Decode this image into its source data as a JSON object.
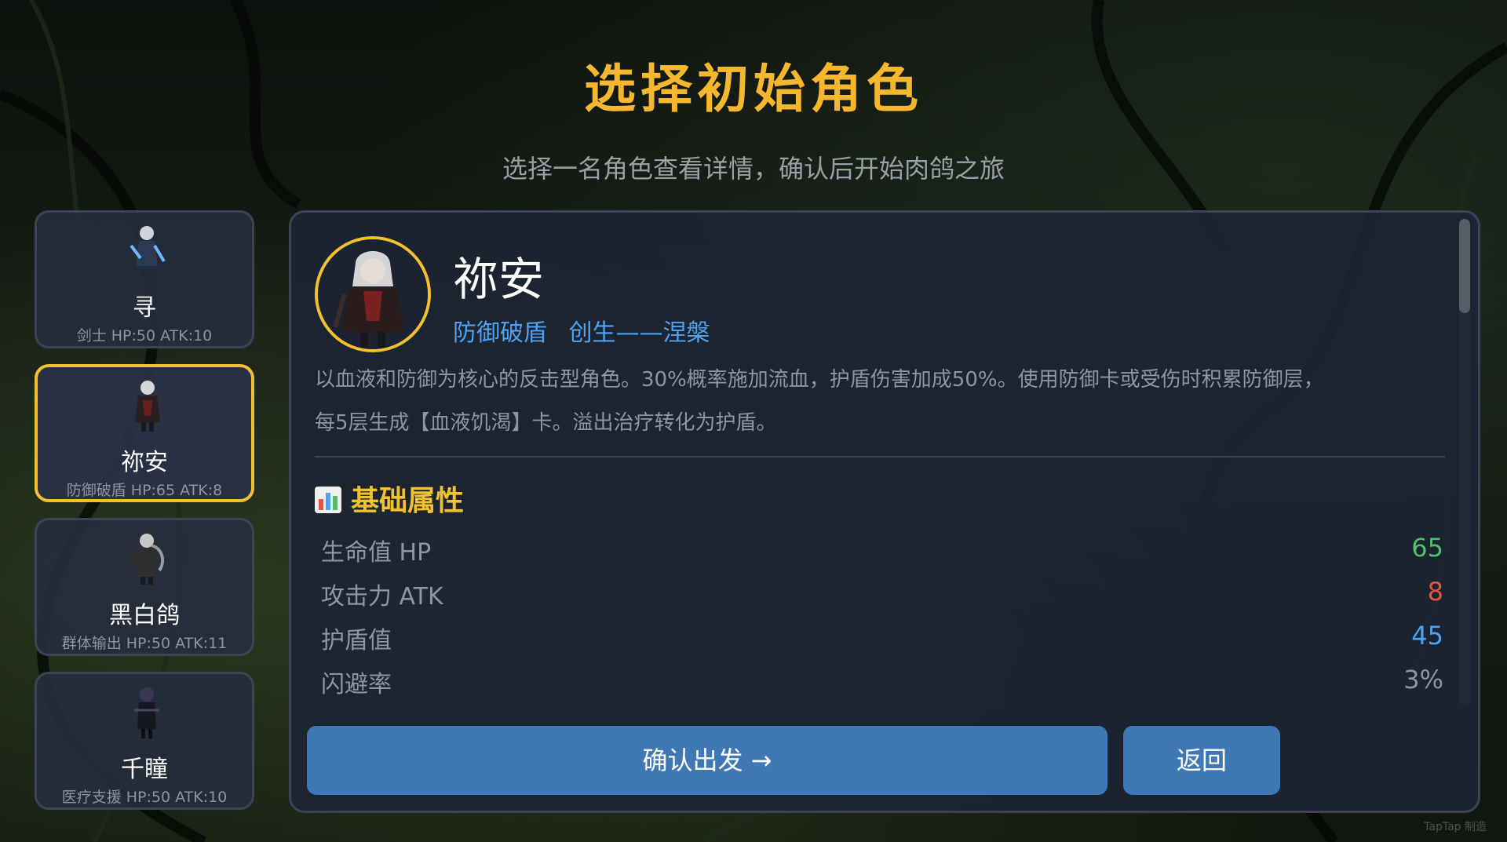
{
  "header": {
    "title": "选择初始角色",
    "subtitle": "选择一名角色查看详情，确认后开始肉鸽之旅"
  },
  "characters": [
    {
      "name": "寻",
      "meta": "剑士  HP:50 ATK:10",
      "selected": false
    },
    {
      "name": "祢安",
      "meta": "防御破盾  HP:65 ATK:8",
      "selected": true
    },
    {
      "name": "黑白鸽",
      "meta": "群体输出  HP:50 ATK:11",
      "selected": false
    },
    {
      "name": "千瞳",
      "meta": "医疗支援  HP:50 ATK:10",
      "selected": false
    }
  ],
  "detail": {
    "name": "祢安",
    "tags": [
      "防御破盾",
      "创生——涅槃"
    ],
    "description_line1": "以血液和防御为核心的反击型角色。30%概率施加流血，护盾伤害加成50%。使用防御卡或受伤时积累防御层，",
    "description_line2": "每5层生成【血液饥渴】卡。溢出治疗转化为护盾。",
    "section_title": "基础属性",
    "section_icon": "bar-chart-icon",
    "attributes": [
      {
        "label": "生命值 HP",
        "value": "65",
        "color": "#4cc26a"
      },
      {
        "label": "攻击力 ATK",
        "value": "8",
        "color": "#e8553f"
      },
      {
        "label": "护盾值",
        "value": "45",
        "color": "#4fa3f0"
      },
      {
        "label": "闪避率",
        "value": "3%",
        "color": "#8e96a3"
      }
    ]
  },
  "buttons": {
    "confirm_label": "确认出发 →",
    "back_label": "返回"
  },
  "watermark": "TapTap 制造",
  "colors": {
    "accent_gold": "#f2c12e",
    "tag_blue": "#4fa3f0",
    "button_blue": "#3f78b4"
  }
}
